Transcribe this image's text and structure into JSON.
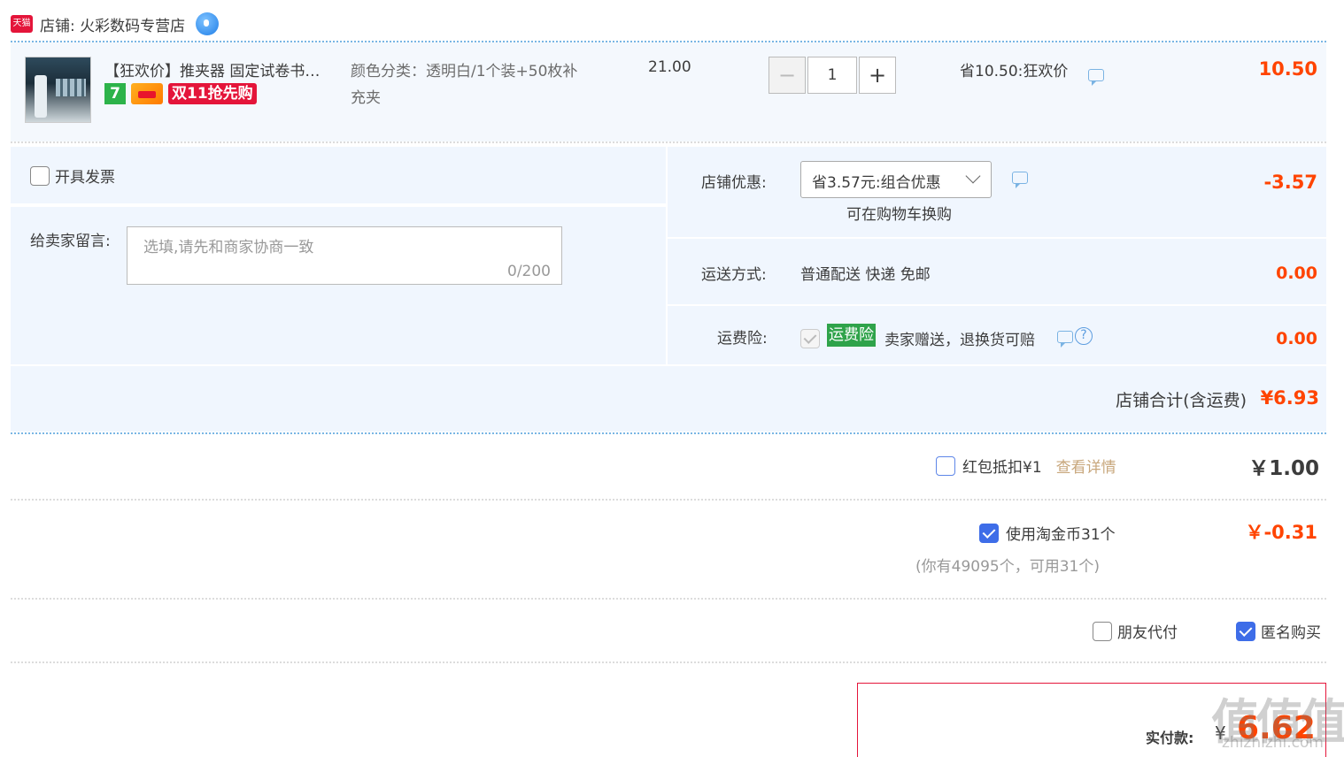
{
  "shop": {
    "logo_text": "天猫",
    "label": "店铺: 火彩数码专营店"
  },
  "item": {
    "title": "【狂欢价】推夹器 固定试卷书…",
    "badge_7": "7",
    "badge_1111": "双11抢先购",
    "sku": "颜色分类：透明白/1个装+50枚补充夹",
    "unit_price": "21.00",
    "quantity": "1",
    "minus": "−",
    "plus": "+",
    "promo": "省10.50:狂欢价",
    "total": "10.50"
  },
  "options": {
    "invoice_label": "开具发票",
    "message_label": "给卖家留言:",
    "message_placeholder": "选填,请先和商家协商一致",
    "message_count": "0/200",
    "coupon_label": "店铺优惠:",
    "coupon_value": "省3.57元:组合优惠",
    "coupon_hint": "可在购物车换购",
    "coupon_amount": "-3.57",
    "shipping_label": "运送方式:",
    "shipping_value": "普通配送 快递 免邮",
    "shipping_amount": "0.00",
    "insurance_label": "运费险:",
    "insurance_tag": "运费险",
    "insurance_text": "卖家赠送，退换货可赔",
    "insurance_amount": "0.00",
    "help_glyph": "?"
  },
  "subtotal": {
    "label": "店铺合计(含运费)",
    "amount": "¥6.93"
  },
  "redpack": {
    "label": "红包抵扣¥1",
    "link": "查看详情",
    "amount": "￥1.00"
  },
  "coin": {
    "label": "使用淘金币31个",
    "note": "(你有49095个，可用31个)",
    "amount": "￥-0.31"
  },
  "extra": {
    "friend_pay": "朋友代付",
    "anonymous": "匿名购买"
  },
  "pay": {
    "label": "实付款:",
    "yen": "¥",
    "amount": "6.62"
  },
  "watermark": {
    "main": "值值值",
    "sub": "zhizhizhi.com"
  },
  "colors": {
    "price_red": "#ff4400",
    "brand_red": "#e4153a",
    "panel_blue": "#f0f6fe",
    "check_blue": "#3e6de8"
  }
}
